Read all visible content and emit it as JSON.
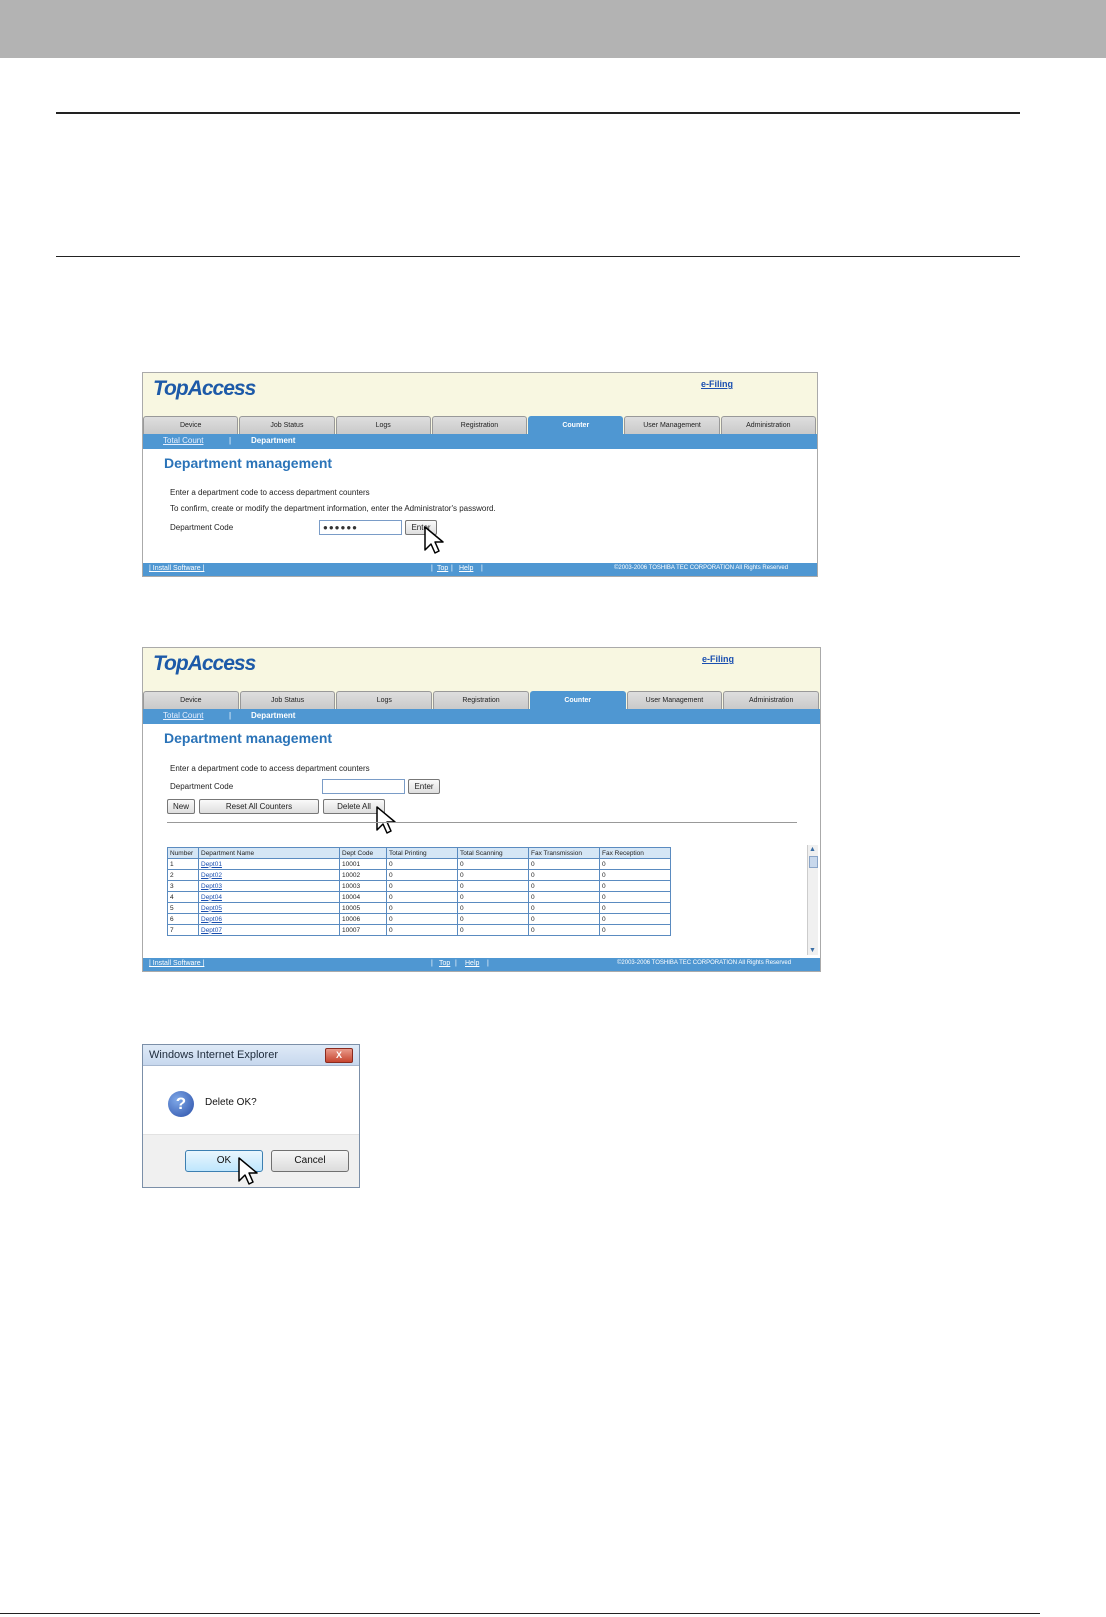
{
  "panel1": {
    "logo": "TopAccess",
    "efiling": "e-Filing",
    "tabs": [
      "Device",
      "Job Status",
      "Logs",
      "Registration",
      "Counter",
      "User Management",
      "Administration"
    ],
    "active_tab": "Counter",
    "subnav": {
      "total_count": "Total Count",
      "separator": "|",
      "department": "Department"
    },
    "page_title": "Department management",
    "instruction1": "Enter a department code to access department counters",
    "instruction2": "To confirm, create or modify the department information, enter the Administrator's password.",
    "dept_code_label": "Department Code",
    "dept_code_value": "●●●●●●",
    "enter_button": "Enter",
    "footer": {
      "install": "| Install Software |",
      "top": "Top",
      "help": "Help",
      "bars": "|",
      "copyright": "©2003-2006 TOSHIBA TEC CORPORATION All Rights Reserved"
    }
  },
  "panel2": {
    "logo": "TopAccess",
    "efiling": "e-Filing",
    "tabs": [
      "Device",
      "Job Status",
      "Logs",
      "Registration",
      "Counter",
      "User Management",
      "Administration"
    ],
    "subnav": {
      "total_count": "Total Count",
      "separator": "|",
      "department": "Department"
    },
    "page_title": "Department management",
    "instruction1": "Enter a department code to access department counters",
    "dept_code_label": "Department Code",
    "enter_button": "Enter",
    "new_button": "New",
    "reset_button": "Reset All Counters",
    "delete_button": "Delete All",
    "table": {
      "headers": [
        "Number",
        "Department Name",
        "Dept Code",
        "Total Printing",
        "Total Scanning",
        "Fax Transmission",
        "Fax Reception"
      ],
      "rows": [
        [
          "1",
          "Dept01",
          "10001",
          "0",
          "0",
          "0",
          "0"
        ],
        [
          "2",
          "Dept02",
          "10002",
          "0",
          "0",
          "0",
          "0"
        ],
        [
          "3",
          "Dept03",
          "10003",
          "0",
          "0",
          "0",
          "0"
        ],
        [
          "4",
          "Dept04",
          "10004",
          "0",
          "0",
          "0",
          "0"
        ],
        [
          "5",
          "Dept05",
          "10005",
          "0",
          "0",
          "0",
          "0"
        ],
        [
          "6",
          "Dept06",
          "10006",
          "0",
          "0",
          "0",
          "0"
        ],
        [
          "7",
          "Dept07",
          "10007",
          "0",
          "0",
          "0",
          "0"
        ]
      ]
    },
    "footer": {
      "install": "| Install Software |",
      "top": "Top",
      "help": "Help",
      "copyright": "©2003-2006 TOSHIBA TEC CORPORATION All Rights Reserved"
    }
  },
  "dialog": {
    "title": "Windows Internet Explorer",
    "close": "X",
    "message": "Delete OK?",
    "ok": "OK",
    "cancel": "Cancel"
  }
}
